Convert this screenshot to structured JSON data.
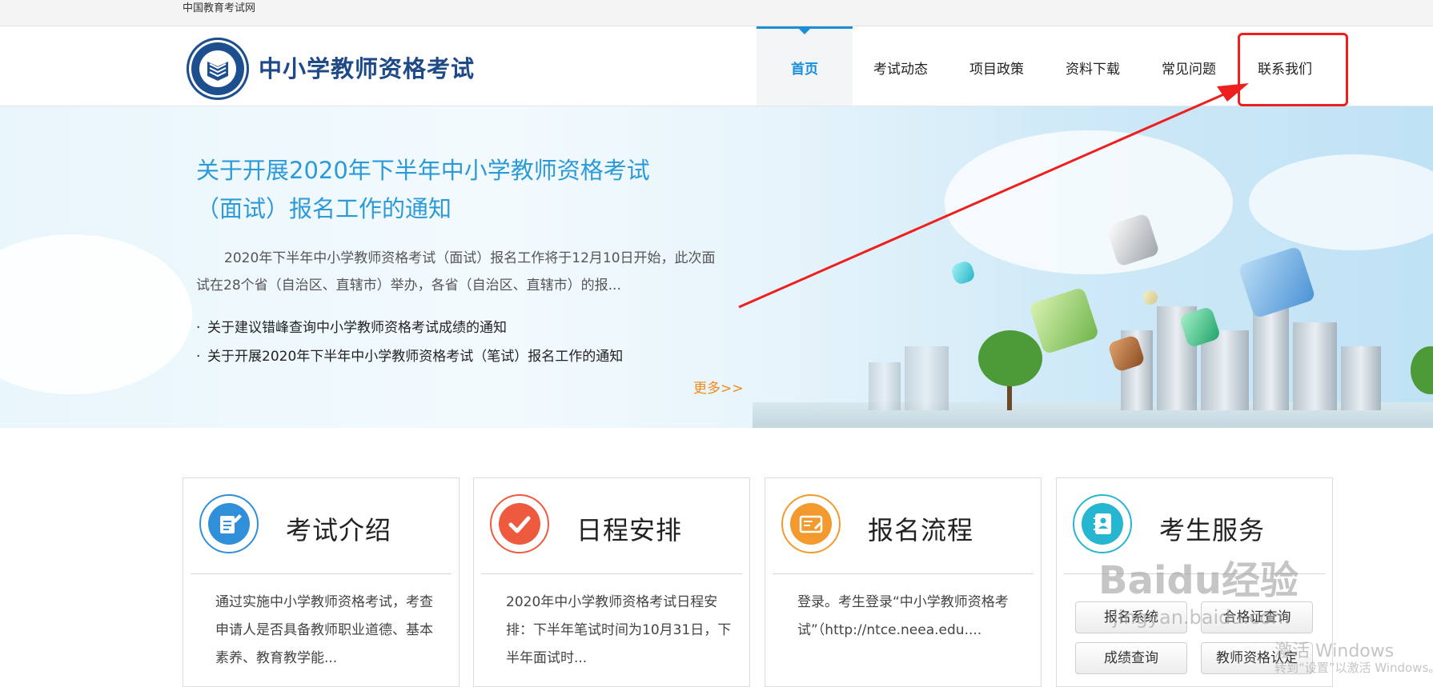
{
  "topbar": {
    "site_name": "中国教育考试网"
  },
  "header": {
    "logo_title": "中小学教师资格考试",
    "nav": [
      {
        "label": "首页",
        "active": true
      },
      {
        "label": "考试动态"
      },
      {
        "label": "项目政策"
      },
      {
        "label": "资料下载"
      },
      {
        "label": "常见问题"
      },
      {
        "label": "联系我们"
      }
    ]
  },
  "banner": {
    "headline_line1": "关于开展2020年下半年中小学教师资格考试",
    "headline_line2": "（面试）报名工作的通知",
    "summary": "2020年下半年中小学教师资格考试（面试）报名工作将于12月10日开始，此次面试在28个省（自治区、直辖市）举办，各省（自治区、直辖市）的报...",
    "news": [
      "关于建议错峰查询中小学教师资格考试成绩的通知",
      "关于开展2020年下半年中小学教师资格考试（笔试）报名工作的通知"
    ],
    "bullet": "·",
    "more": "更多>>"
  },
  "cards": [
    {
      "title": "考试介绍",
      "icon": "document-edit-icon",
      "color": "#2f8fd9",
      "desc": "通过实施中小学教师资格考试，考查申请人是否具备教师职业道德、基本素养、教育教学能..."
    },
    {
      "title": "日程安排",
      "icon": "checkmark-icon",
      "color": "#ee5a3d",
      "desc": "2020年中小学教师资格考试日程安排：下半年笔试时间为10月31日，下半年面试时..."
    },
    {
      "title": "报名流程",
      "icon": "id-card-icon",
      "color": "#f29a2e",
      "desc": "登录。考生登录“中小学教师资格考试”（http://ntce.neea.edu...."
    },
    {
      "title": "考生服务",
      "icon": "contact-book-icon",
      "color": "#27b6cf",
      "buttons": [
        "报名系统",
        "合格证查询",
        "成绩查询",
        "教师资格认定"
      ]
    }
  ],
  "watermarks": {
    "baidu": "Baidu经验",
    "baidu_url": "jingyan.baidu.com",
    "windows_line1": "激活 Windows",
    "windows_line2": "转到“设置”以激活 Windows。"
  },
  "colors": {
    "brand_blue": "#1f4a87",
    "accent_blue": "#1a8fd8",
    "highlight_red": "#ee1f1f",
    "more_orange": "#f08a1e"
  }
}
